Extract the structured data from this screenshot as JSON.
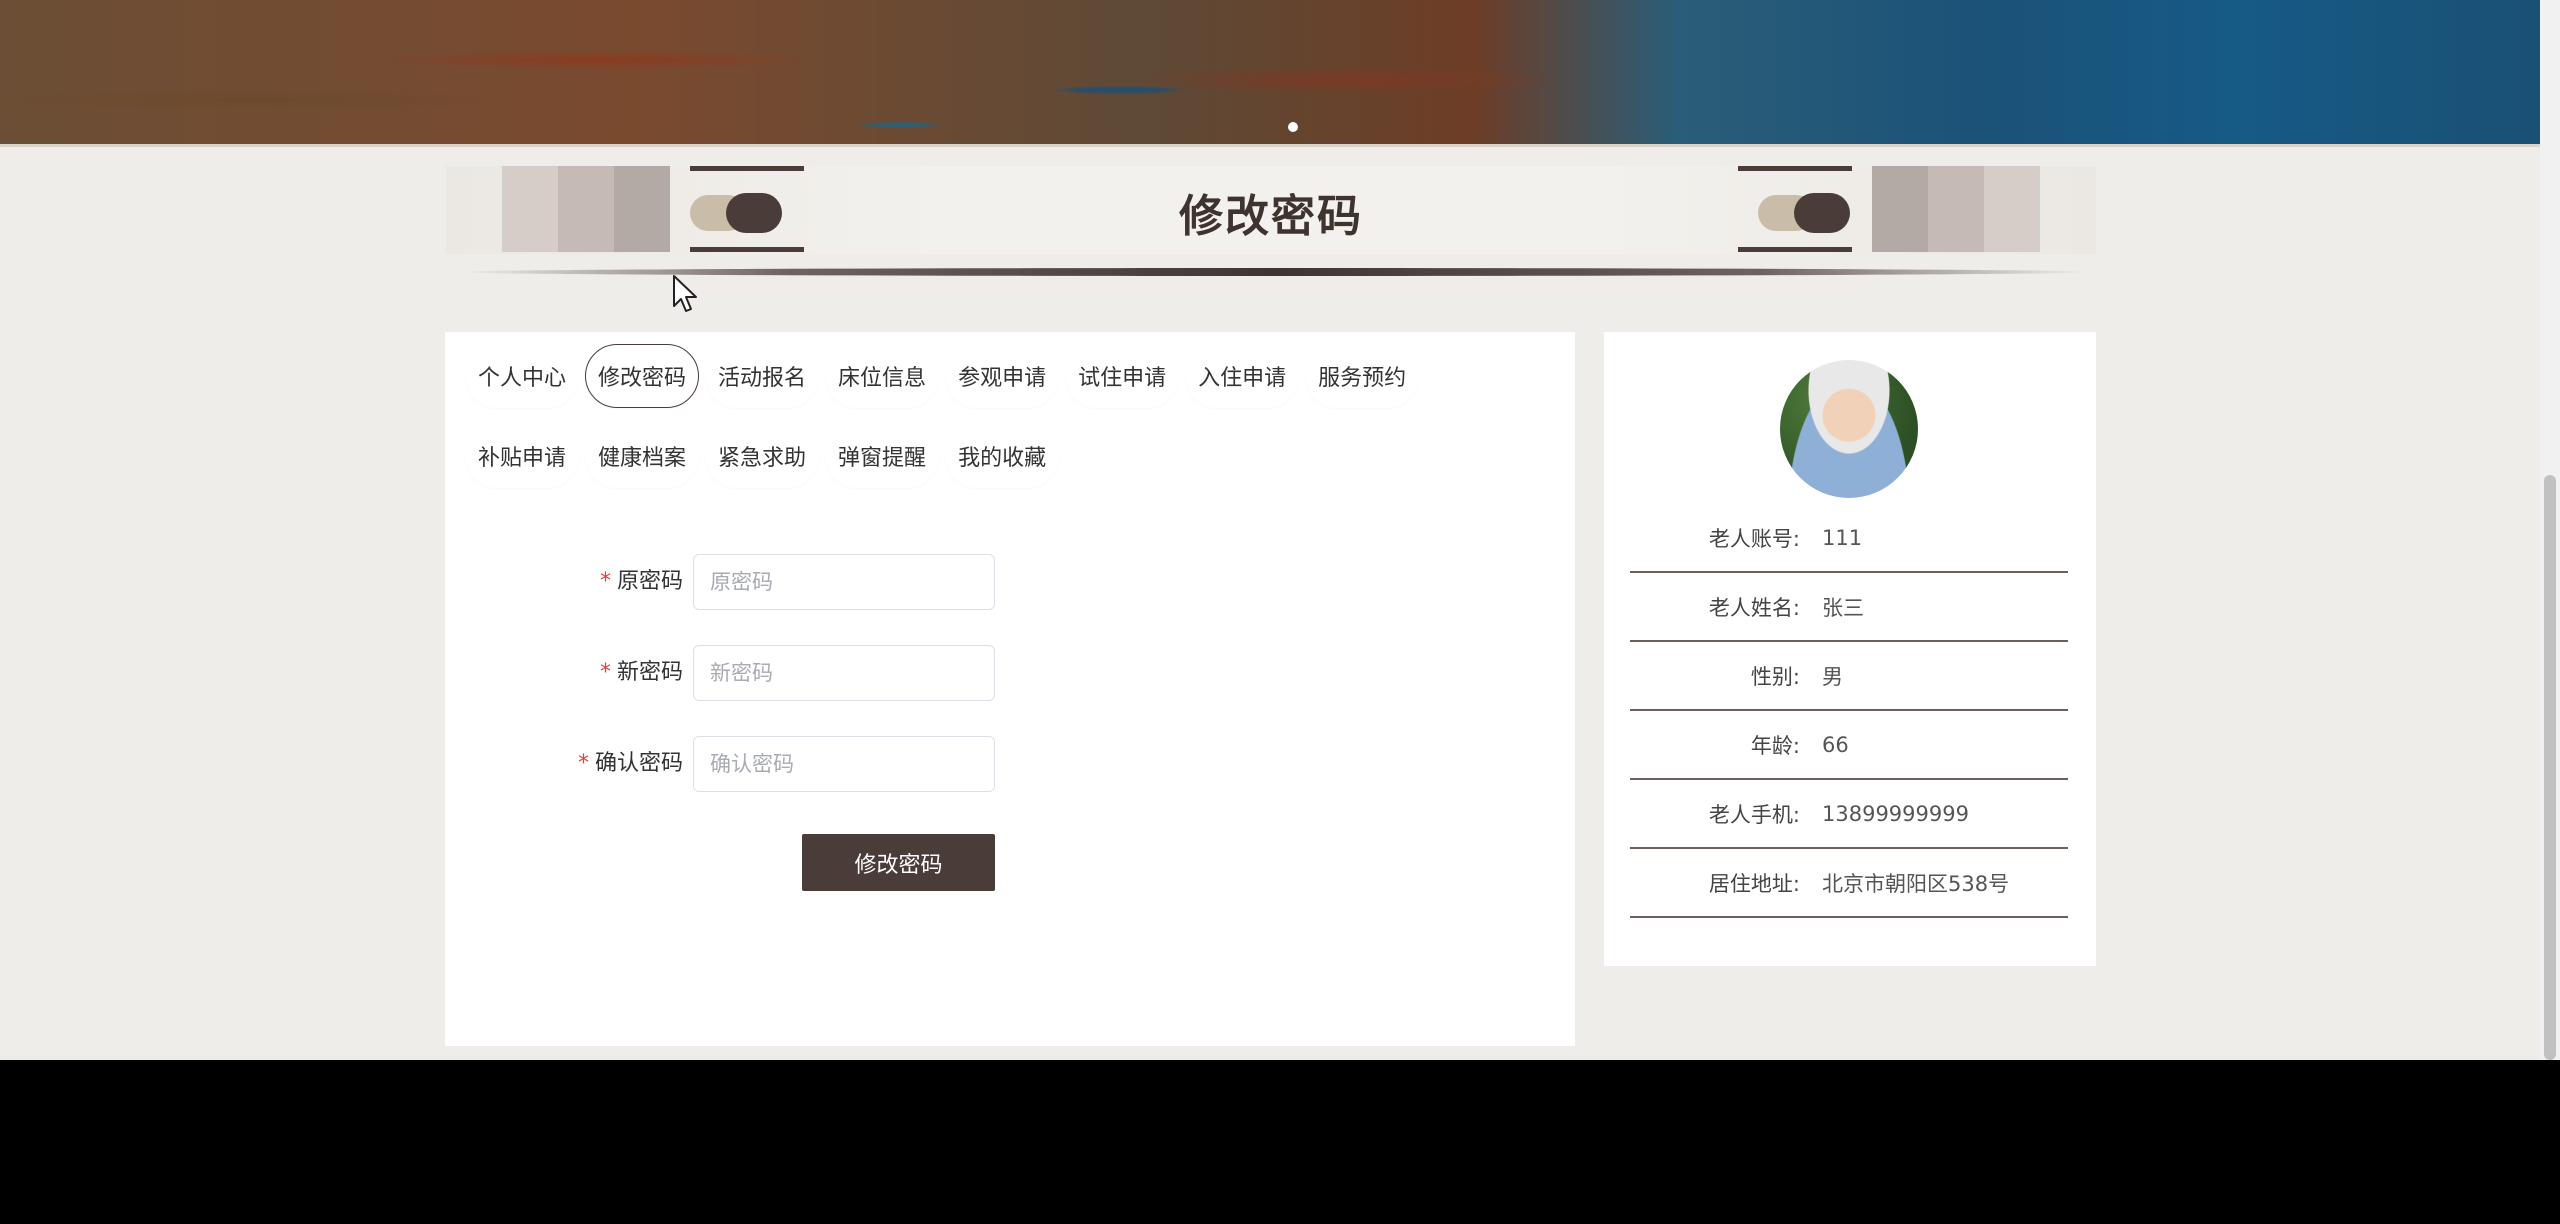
{
  "page": {
    "title": "修改密码"
  },
  "tabs": {
    "row1": [
      "个人中心",
      "修改密码",
      "活动报名",
      "床位信息",
      "参观申请",
      "试住申请",
      "入住申请",
      "服务预约"
    ],
    "row2": [
      "补贴申请",
      "健康档案",
      "紧急求助",
      "弹窗提醒",
      "我的收藏"
    ],
    "active": "修改密码"
  },
  "form": {
    "required_mark": "*",
    "old_password": {
      "label": "原密码",
      "placeholder": "原密码",
      "value": ""
    },
    "new_password": {
      "label": "新密码",
      "placeholder": "新密码",
      "value": ""
    },
    "confirm_password": {
      "label": "确认密码",
      "placeholder": "确认密码",
      "value": ""
    },
    "submit_label": "修改密码"
  },
  "profile": {
    "fields": [
      {
        "label": "老人账号:",
        "value": "111"
      },
      {
        "label": "老人姓名:",
        "value": "张三"
      },
      {
        "label": "性别:",
        "value": "男"
      },
      {
        "label": "年龄:",
        "value": "66"
      },
      {
        "label": "老人手机:",
        "value": "13899999999"
      },
      {
        "label": "居住地址:",
        "value": "北京市朝阳区538号"
      }
    ]
  },
  "colors": {
    "accent": "#4a3c38",
    "required": "#e53e3e",
    "page_bg": "#efede9"
  }
}
